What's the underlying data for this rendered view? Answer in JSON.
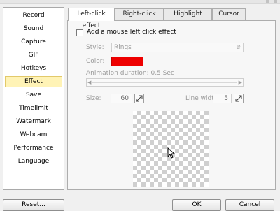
{
  "sidebar": {
    "items": [
      {
        "label": "Record"
      },
      {
        "label": "Sound"
      },
      {
        "label": "Capture"
      },
      {
        "label": "GIF"
      },
      {
        "label": "Hotkeys"
      },
      {
        "label": "Effect",
        "selected": true
      },
      {
        "label": "Save"
      },
      {
        "label": "Timelimit"
      },
      {
        "label": "Watermark"
      },
      {
        "label": "Webcam"
      },
      {
        "label": "Performance"
      },
      {
        "label": "Language"
      }
    ]
  },
  "tabs": [
    {
      "label": "Left-click effect",
      "active": true
    },
    {
      "label": "Right-click effect"
    },
    {
      "label": "Highlight effect"
    },
    {
      "label": "Cursor size"
    }
  ],
  "panel": {
    "checkbox_label": "Add a mouse left click effect",
    "checkbox_checked": false,
    "style_label": "Style:",
    "style_value": "Rings",
    "color_label": "Color:",
    "color_value": "#ee0000",
    "duration_label": "Animation duration: 0,5 Sec",
    "size_label": "Size:",
    "size_value": "60",
    "line_width_label": "Line width:",
    "line_width_value": "5"
  },
  "footer": {
    "reset_label": "Reset...",
    "ok_label": "OK",
    "cancel_label": "Cancel"
  },
  "icons": {
    "dropdown": "chevron-updown-icon",
    "slider_left": "arrow-left-icon",
    "slider_right": "arrow-right-icon",
    "resize": "resize-icon",
    "cursor": "mouse-pointer-icon"
  }
}
